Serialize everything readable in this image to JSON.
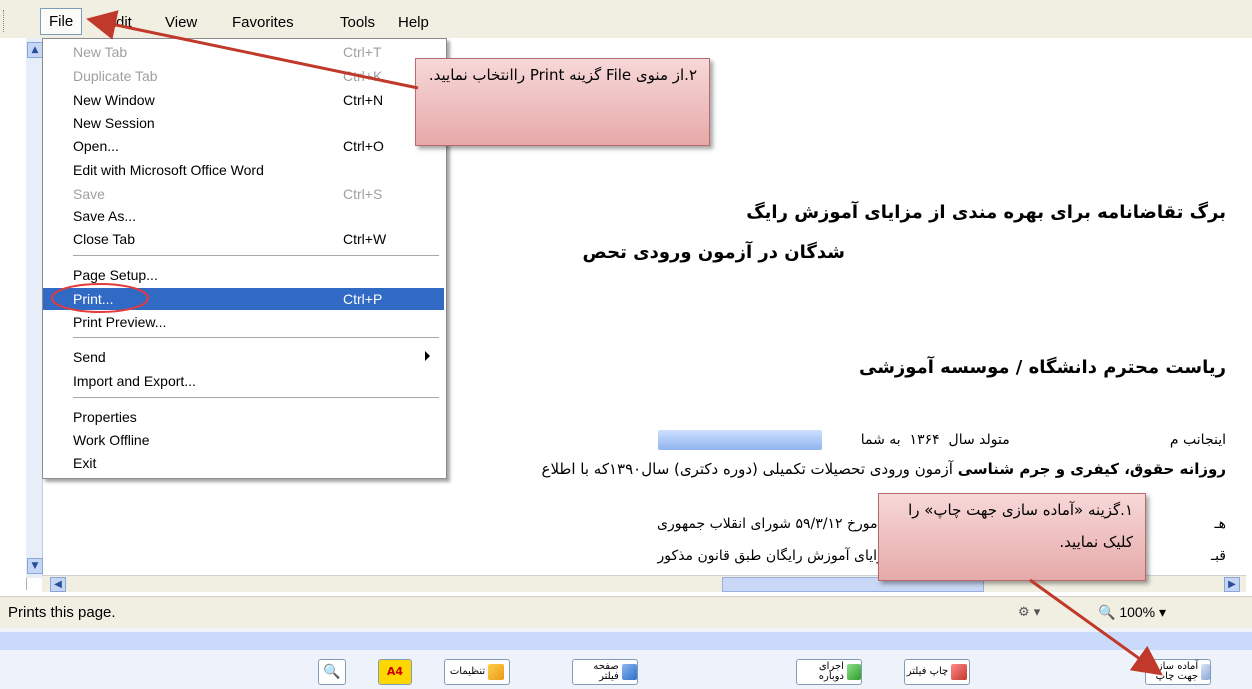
{
  "menubar": {
    "items": [
      "File",
      "Edit",
      "View",
      "Favorites",
      "Tools",
      "Help"
    ]
  },
  "file_menu": {
    "items": [
      {
        "label": "New Tab",
        "shortcut": "Ctrl+T",
        "disabled": true
      },
      {
        "label": "Duplicate Tab",
        "shortcut": "Ctrl+K",
        "disabled": true
      },
      {
        "label": "New Window",
        "shortcut": "Ctrl+N"
      },
      {
        "label": "New Session",
        "shortcut": ""
      },
      {
        "label": "Open...",
        "shortcut": "Ctrl+O"
      },
      {
        "label": "Edit with Microsoft Office Word",
        "shortcut": ""
      },
      {
        "label": "Save",
        "shortcut": "Ctrl+S",
        "disabled": true
      },
      {
        "label": "Save As...",
        "shortcut": ""
      },
      {
        "label": "Close Tab",
        "shortcut": "Ctrl+W"
      },
      {
        "label": "Page Setup...",
        "shortcut": ""
      },
      {
        "label": "Print...",
        "shortcut": "Ctrl+P",
        "selected": true
      },
      {
        "label": "Print Preview...",
        "shortcut": ""
      },
      {
        "label": "Send",
        "shortcut": "",
        "submenu": true
      },
      {
        "label": "Import and Export...",
        "shortcut": ""
      },
      {
        "label": "Properties",
        "shortcut": ""
      },
      {
        "label": "Work Offline",
        "shortcut": ""
      },
      {
        "label": "Exit",
        "shortcut": ""
      }
    ]
  },
  "document": {
    "title_line1": "برگ تقاضانامه برای بهره مندی از مزایای آموزش رایگ",
    "title_line2": "شدگان در آزمون ورودی تحص",
    "salutation": "ریاست محترم دانشگاه / موسسه آموزشی",
    "para1": "اینجانب م                                    متولد سال  ۱۳۶۴  به شما",
    "para2_bold": "روزانه حقوق، کیفری و جرم شناسی",
    "para2_rest": " آزمون ورودی تحصیلات تکمیلی (دوره دکتری) سال۱۳۹۰که با اطلاع",
    "para3": "هـ                   تحصیل اطفال و جوانان ایرانی که در جلسه مورخ ۵۹/۳/۱۲ شورای انقلاب جمهوری",
    "para4": "قبـ                 مند هستم در طول تحصیل دوره دکتری از مزایای آموزش رایگان طبق قانون مذکور"
  },
  "callouts": {
    "top": "۲.از منوی File گزینه Print راانتخاب نمایید.",
    "bottom": "۱.گزینه «آماده سازی جهت چاپ» را کلیک نمایید."
  },
  "status": {
    "text": "Prints this page.",
    "zoom": "100%"
  },
  "toolbar": {
    "buttons": [
      {
        "label": "A4"
      },
      {
        "label": "تنظیمات"
      },
      {
        "label": "صفحه فیلتر"
      },
      {
        "label": "اجرای دوباره"
      },
      {
        "label": "چاپ فیلتر"
      },
      {
        "label": "آماده سازی جهت چاپ"
      }
    ]
  },
  "colors": {
    "menu_highlight": "#316ac5",
    "callout": "#e6a9a9",
    "arrow": "#c0392b",
    "menubar": "#f1efe2"
  }
}
